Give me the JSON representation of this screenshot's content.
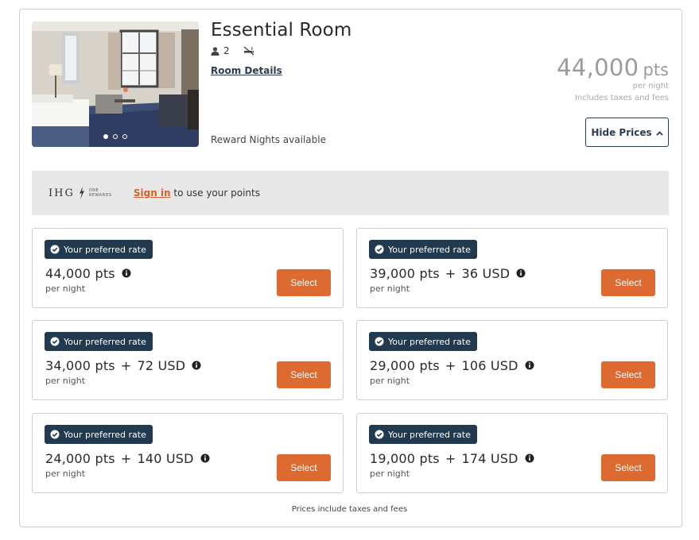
{
  "room": {
    "title": "Essential Room",
    "guests": "2",
    "details_link": "Room Details",
    "availability": "Reward Nights available",
    "price_number": "44,000",
    "price_unit": "pts",
    "per_night": "per night",
    "includes": "Includes taxes and fees",
    "hide_prices": "Hide Prices",
    "carousel": {
      "total": 3,
      "active": 1
    }
  },
  "banner": {
    "logo_text": "IHG",
    "logo_sub": "ONE REWARDS",
    "signin_link": "Sign in",
    "signin_text": " to use your points"
  },
  "rates": [
    {
      "badge": "Your preferred rate",
      "points": "44,000 pts",
      "cash": "",
      "per": "per night",
      "select": "Select"
    },
    {
      "badge": "Your preferred rate",
      "points": "39,000 pts",
      "cash": "36 USD",
      "per": "per night",
      "select": "Select"
    },
    {
      "badge": "Your preferred rate",
      "points": "34,000 pts",
      "cash": "72 USD",
      "per": "per night",
      "select": "Select"
    },
    {
      "badge": "Your preferred rate",
      "points": "29,000 pts",
      "cash": "106 USD",
      "per": "per night",
      "select": "Select"
    },
    {
      "badge": "Your preferred rate",
      "points": "24,000 pts",
      "cash": "140 USD",
      "per": "per night",
      "select": "Select"
    },
    {
      "badge": "Your preferred rate",
      "points": "19,000 pts",
      "cash": "174 USD",
      "per": "per night",
      "select": "Select"
    }
  ],
  "footer": {
    "note": "Prices include taxes and fees"
  },
  "colors": {
    "accent": "#dd6a31",
    "badge": "#213a4f",
    "link": "#2b3c4e",
    "signin": "#d2612e"
  }
}
